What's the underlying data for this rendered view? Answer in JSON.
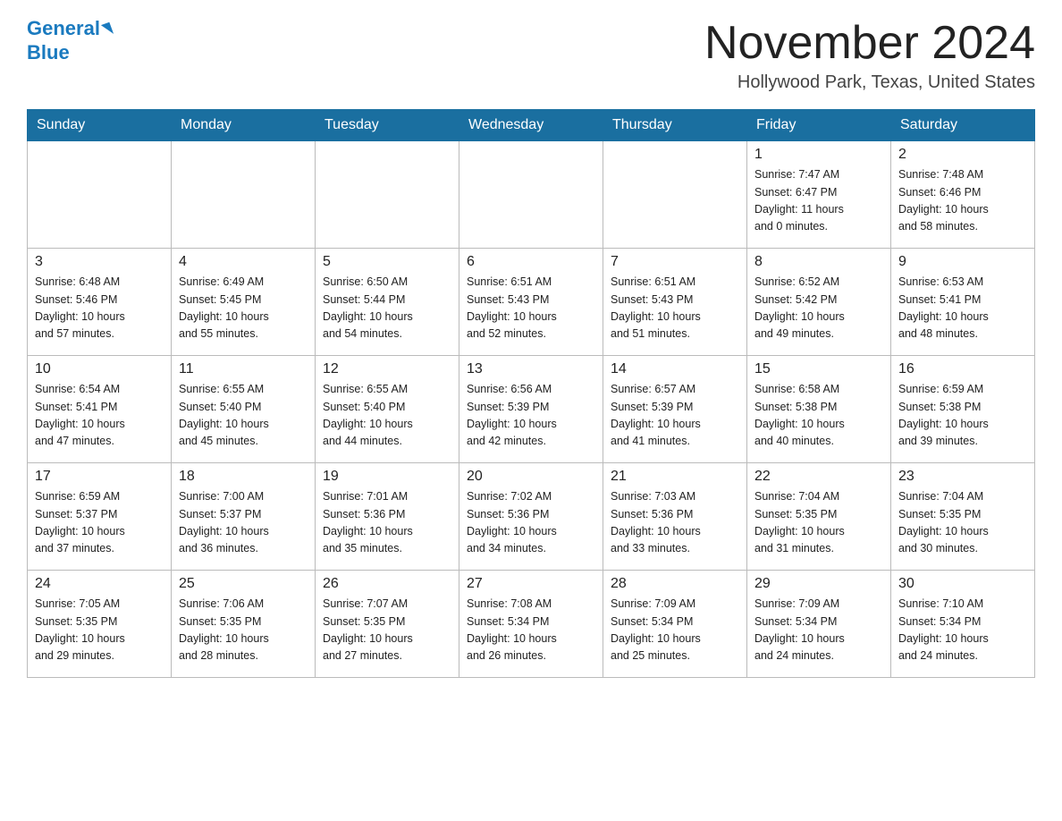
{
  "logo": {
    "text_black": "General",
    "text_blue": "Blue"
  },
  "header": {
    "title": "November 2024",
    "location": "Hollywood Park, Texas, United States"
  },
  "weekdays": [
    "Sunday",
    "Monday",
    "Tuesday",
    "Wednesday",
    "Thursday",
    "Friday",
    "Saturday"
  ],
  "weeks": [
    [
      {
        "day": "",
        "info": ""
      },
      {
        "day": "",
        "info": ""
      },
      {
        "day": "",
        "info": ""
      },
      {
        "day": "",
        "info": ""
      },
      {
        "day": "",
        "info": ""
      },
      {
        "day": "1",
        "info": "Sunrise: 7:47 AM\nSunset: 6:47 PM\nDaylight: 11 hours\nand 0 minutes."
      },
      {
        "day": "2",
        "info": "Sunrise: 7:48 AM\nSunset: 6:46 PM\nDaylight: 10 hours\nand 58 minutes."
      }
    ],
    [
      {
        "day": "3",
        "info": "Sunrise: 6:48 AM\nSunset: 5:46 PM\nDaylight: 10 hours\nand 57 minutes."
      },
      {
        "day": "4",
        "info": "Sunrise: 6:49 AM\nSunset: 5:45 PM\nDaylight: 10 hours\nand 55 minutes."
      },
      {
        "day": "5",
        "info": "Sunrise: 6:50 AM\nSunset: 5:44 PM\nDaylight: 10 hours\nand 54 minutes."
      },
      {
        "day": "6",
        "info": "Sunrise: 6:51 AM\nSunset: 5:43 PM\nDaylight: 10 hours\nand 52 minutes."
      },
      {
        "day": "7",
        "info": "Sunrise: 6:51 AM\nSunset: 5:43 PM\nDaylight: 10 hours\nand 51 minutes."
      },
      {
        "day": "8",
        "info": "Sunrise: 6:52 AM\nSunset: 5:42 PM\nDaylight: 10 hours\nand 49 minutes."
      },
      {
        "day": "9",
        "info": "Sunrise: 6:53 AM\nSunset: 5:41 PM\nDaylight: 10 hours\nand 48 minutes."
      }
    ],
    [
      {
        "day": "10",
        "info": "Sunrise: 6:54 AM\nSunset: 5:41 PM\nDaylight: 10 hours\nand 47 minutes."
      },
      {
        "day": "11",
        "info": "Sunrise: 6:55 AM\nSunset: 5:40 PM\nDaylight: 10 hours\nand 45 minutes."
      },
      {
        "day": "12",
        "info": "Sunrise: 6:55 AM\nSunset: 5:40 PM\nDaylight: 10 hours\nand 44 minutes."
      },
      {
        "day": "13",
        "info": "Sunrise: 6:56 AM\nSunset: 5:39 PM\nDaylight: 10 hours\nand 42 minutes."
      },
      {
        "day": "14",
        "info": "Sunrise: 6:57 AM\nSunset: 5:39 PM\nDaylight: 10 hours\nand 41 minutes."
      },
      {
        "day": "15",
        "info": "Sunrise: 6:58 AM\nSunset: 5:38 PM\nDaylight: 10 hours\nand 40 minutes."
      },
      {
        "day": "16",
        "info": "Sunrise: 6:59 AM\nSunset: 5:38 PM\nDaylight: 10 hours\nand 39 minutes."
      }
    ],
    [
      {
        "day": "17",
        "info": "Sunrise: 6:59 AM\nSunset: 5:37 PM\nDaylight: 10 hours\nand 37 minutes."
      },
      {
        "day": "18",
        "info": "Sunrise: 7:00 AM\nSunset: 5:37 PM\nDaylight: 10 hours\nand 36 minutes."
      },
      {
        "day": "19",
        "info": "Sunrise: 7:01 AM\nSunset: 5:36 PM\nDaylight: 10 hours\nand 35 minutes."
      },
      {
        "day": "20",
        "info": "Sunrise: 7:02 AM\nSunset: 5:36 PM\nDaylight: 10 hours\nand 34 minutes."
      },
      {
        "day": "21",
        "info": "Sunrise: 7:03 AM\nSunset: 5:36 PM\nDaylight: 10 hours\nand 33 minutes."
      },
      {
        "day": "22",
        "info": "Sunrise: 7:04 AM\nSunset: 5:35 PM\nDaylight: 10 hours\nand 31 minutes."
      },
      {
        "day": "23",
        "info": "Sunrise: 7:04 AM\nSunset: 5:35 PM\nDaylight: 10 hours\nand 30 minutes."
      }
    ],
    [
      {
        "day": "24",
        "info": "Sunrise: 7:05 AM\nSunset: 5:35 PM\nDaylight: 10 hours\nand 29 minutes."
      },
      {
        "day": "25",
        "info": "Sunrise: 7:06 AM\nSunset: 5:35 PM\nDaylight: 10 hours\nand 28 minutes."
      },
      {
        "day": "26",
        "info": "Sunrise: 7:07 AM\nSunset: 5:35 PM\nDaylight: 10 hours\nand 27 minutes."
      },
      {
        "day": "27",
        "info": "Sunrise: 7:08 AM\nSunset: 5:34 PM\nDaylight: 10 hours\nand 26 minutes."
      },
      {
        "day": "28",
        "info": "Sunrise: 7:09 AM\nSunset: 5:34 PM\nDaylight: 10 hours\nand 25 minutes."
      },
      {
        "day": "29",
        "info": "Sunrise: 7:09 AM\nSunset: 5:34 PM\nDaylight: 10 hours\nand 24 minutes."
      },
      {
        "day": "30",
        "info": "Sunrise: 7:10 AM\nSunset: 5:34 PM\nDaylight: 10 hours\nand 24 minutes."
      }
    ]
  ]
}
